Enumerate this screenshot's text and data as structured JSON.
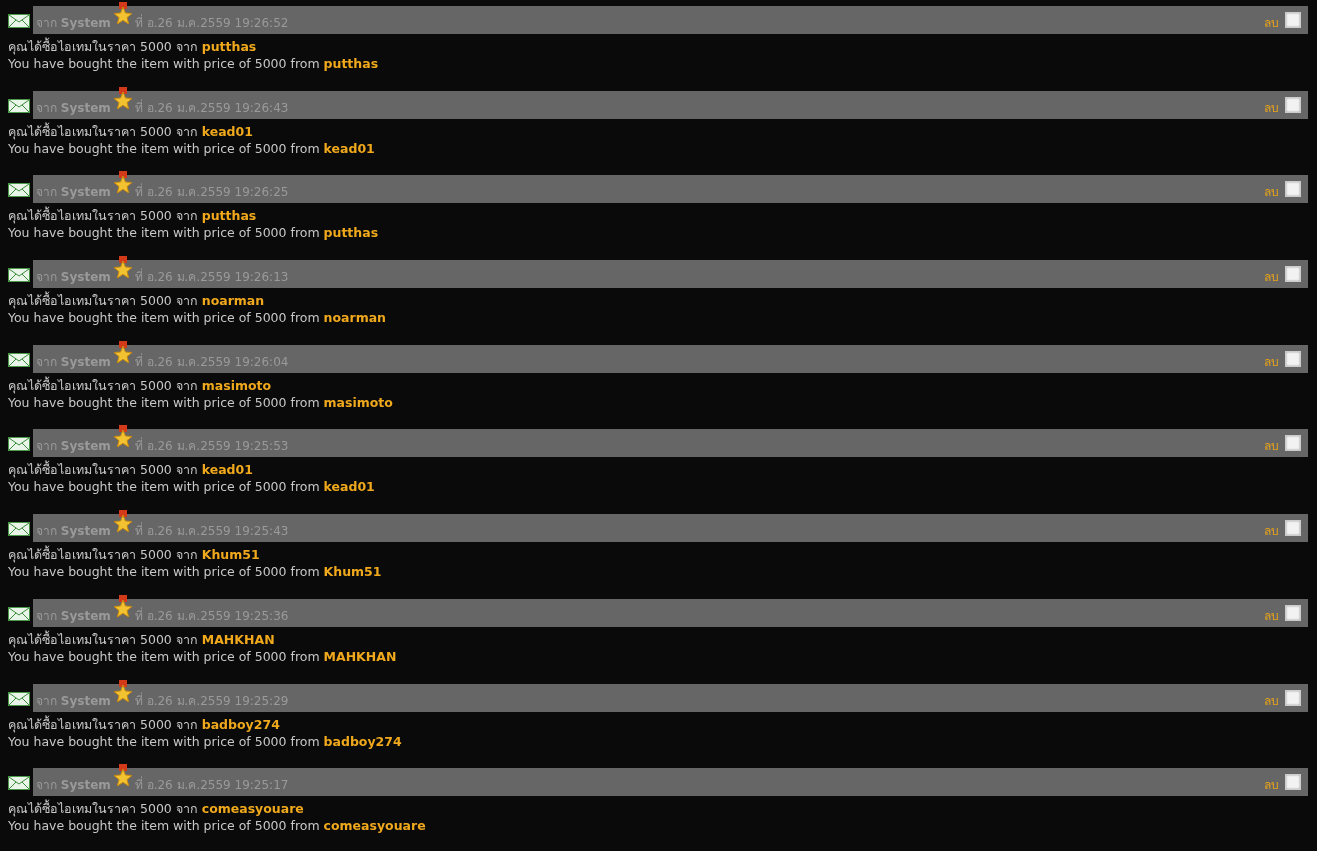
{
  "messages": [
    {
      "from": "จาก **System**",
      "date": "ที่ อ.26 ม.ค.2559 19:26:52",
      "delete": "ลบ",
      "checked": false,
      "thai": "คุณได้ซื้อไอเทมในราคา 5000 จาก **putthas**",
      "english": "You have bought the item with price of 5000 from **putthas**"
    },
    {
      "from": "จาก **System**",
      "date": "ที่ อ.26 ม.ค.2559 19:26:43",
      "delete": "ลบ",
      "checked": false,
      "thai": "คุณได้ซื้อไอเทมในราคา 5000 จาก **kead01**",
      "english": "You have bought the item with price of 5000 from **kead01**"
    },
    {
      "from": "จาก **System**",
      "date": "ที่ อ.26 ม.ค.2559 19:26:25",
      "delete": "ลบ",
      "checked": false,
      "thai": "คุณได้ซื้อไอเทมในราคา 5000 จาก **putthas**",
      "english": "You have bought the item with price of 5000 from **putthas**"
    },
    {
      "from": "จาก **System**",
      "date": "ที่ อ.26 ม.ค.2559 19:26:13",
      "delete": "ลบ",
      "checked": false,
      "thai": "คุณได้ซื้อไอเทมในราคา 5000 จาก **noarman**",
      "english": "You have bought the item with price of 5000 from **noarman**"
    },
    {
      "from": "จาก **System**",
      "date": "ที่ อ.26 ม.ค.2559 19:26:04",
      "delete": "ลบ",
      "checked": false,
      "thai": "คุณได้ซื้อไอเทมในราคา 5000 จาก **masimoto**",
      "english": "You have bought the item with price of 5000 from **masimoto**"
    },
    {
      "from": "จาก **System**",
      "date": "ที่ อ.26 ม.ค.2559 19:25:53",
      "delete": "ลบ",
      "checked": false,
      "thai": "คุณได้ซื้อไอเทมในราคา 5000 จาก **kead01**",
      "english": "You have bought the item with price of 5000 from **kead01**"
    },
    {
      "from": "จาก **System**",
      "date": "ที่ อ.26 ม.ค.2559 19:25:43",
      "delete": "ลบ",
      "checked": false,
      "thai": "คุณได้ซื้อไอเทมในราคา 5000 จาก **Khum51**",
      "english": "You have bought the item with price of 5000 from **Khum51**"
    },
    {
      "from": "จาก **System**",
      "date": "ที่ อ.26 ม.ค.2559 19:25:36",
      "delete": "ลบ",
      "checked": false,
      "thai": "คุณได้ซื้อไอเทมในราคา 5000 จาก **MAHKHAN**",
      "english": "You have bought the item with price of 5000 from **MAHKHAN**"
    },
    {
      "from": "จาก **System**",
      "date": "ที่ อ.26 ม.ค.2559 19:25:29",
      "delete": "ลบ",
      "checked": false,
      "thai": "คุณได้ซื้อไอเทมในราคา 5000 จาก **badboy274**",
      "english": "You have bought the item with price of 5000 from **badboy274**"
    },
    {
      "from": "จาก **System**",
      "date": "ที่ อ.26 ม.ค.2559 19:25:17",
      "delete": "ลบ",
      "checked": false,
      "thai": "คุณได้ซื้อไอเทมในราคา 5000 จาก **comeasyouare**",
      "english": "You have bought the item with price of 5000 from **comeasyouare**"
    }
  ]
}
